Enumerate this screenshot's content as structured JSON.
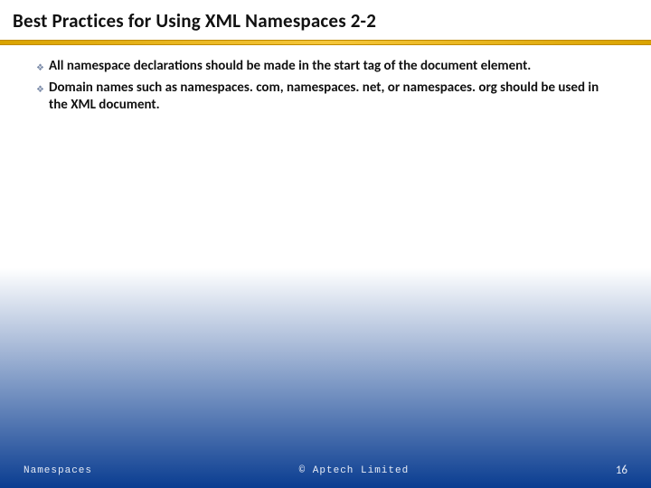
{
  "title": "Best Practices for Using XML Namespaces 2-2",
  "bullets": [
    "All namespace declarations should be made in the start tag of the document element.",
    "Domain names such as namespaces. com, namespaces. net, or namespaces. org should be used in the XML document."
  ],
  "footer": {
    "left": "Namespaces",
    "center": "© Aptech Limited",
    "page": "16"
  }
}
